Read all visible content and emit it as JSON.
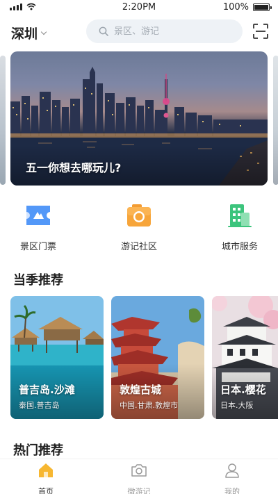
{
  "status_bar": {
    "time": "2:20PM",
    "battery": "100%",
    "battery_level": 1.0
  },
  "header": {
    "city": "深圳",
    "search_placeholder": "景区、游记"
  },
  "banner": {
    "caption": "五一你想去哪玩儿?"
  },
  "quick_entries": [
    {
      "label": "景区门票",
      "icon": "ticket-icon",
      "color": "#3d8bf5"
    },
    {
      "label": "游记社区",
      "icon": "camera-icon",
      "color": "#f7a53a"
    },
    {
      "label": "城市服务",
      "icon": "building-icon",
      "color": "#3cc47c"
    }
  ],
  "sections": {
    "seasonal": "当季推荐",
    "hot": "热门推荐"
  },
  "cards": [
    {
      "title": "普吉岛.沙滩",
      "subtitle": "泰国.普吉岛"
    },
    {
      "title": "敦煌古城",
      "subtitle": "中国.甘肃.敦煌市"
    },
    {
      "title": "日本.樱花",
      "subtitle": "日本.大阪"
    }
  ],
  "tabbar": [
    {
      "label": "首页",
      "icon": "home-icon",
      "active": true
    },
    {
      "label": "微游记",
      "icon": "camera-icon",
      "active": false
    },
    {
      "label": "我的",
      "icon": "user-icon",
      "active": false
    }
  ],
  "colors": {
    "accent": "#f7b731",
    "search_bg": "#eef2f6"
  }
}
